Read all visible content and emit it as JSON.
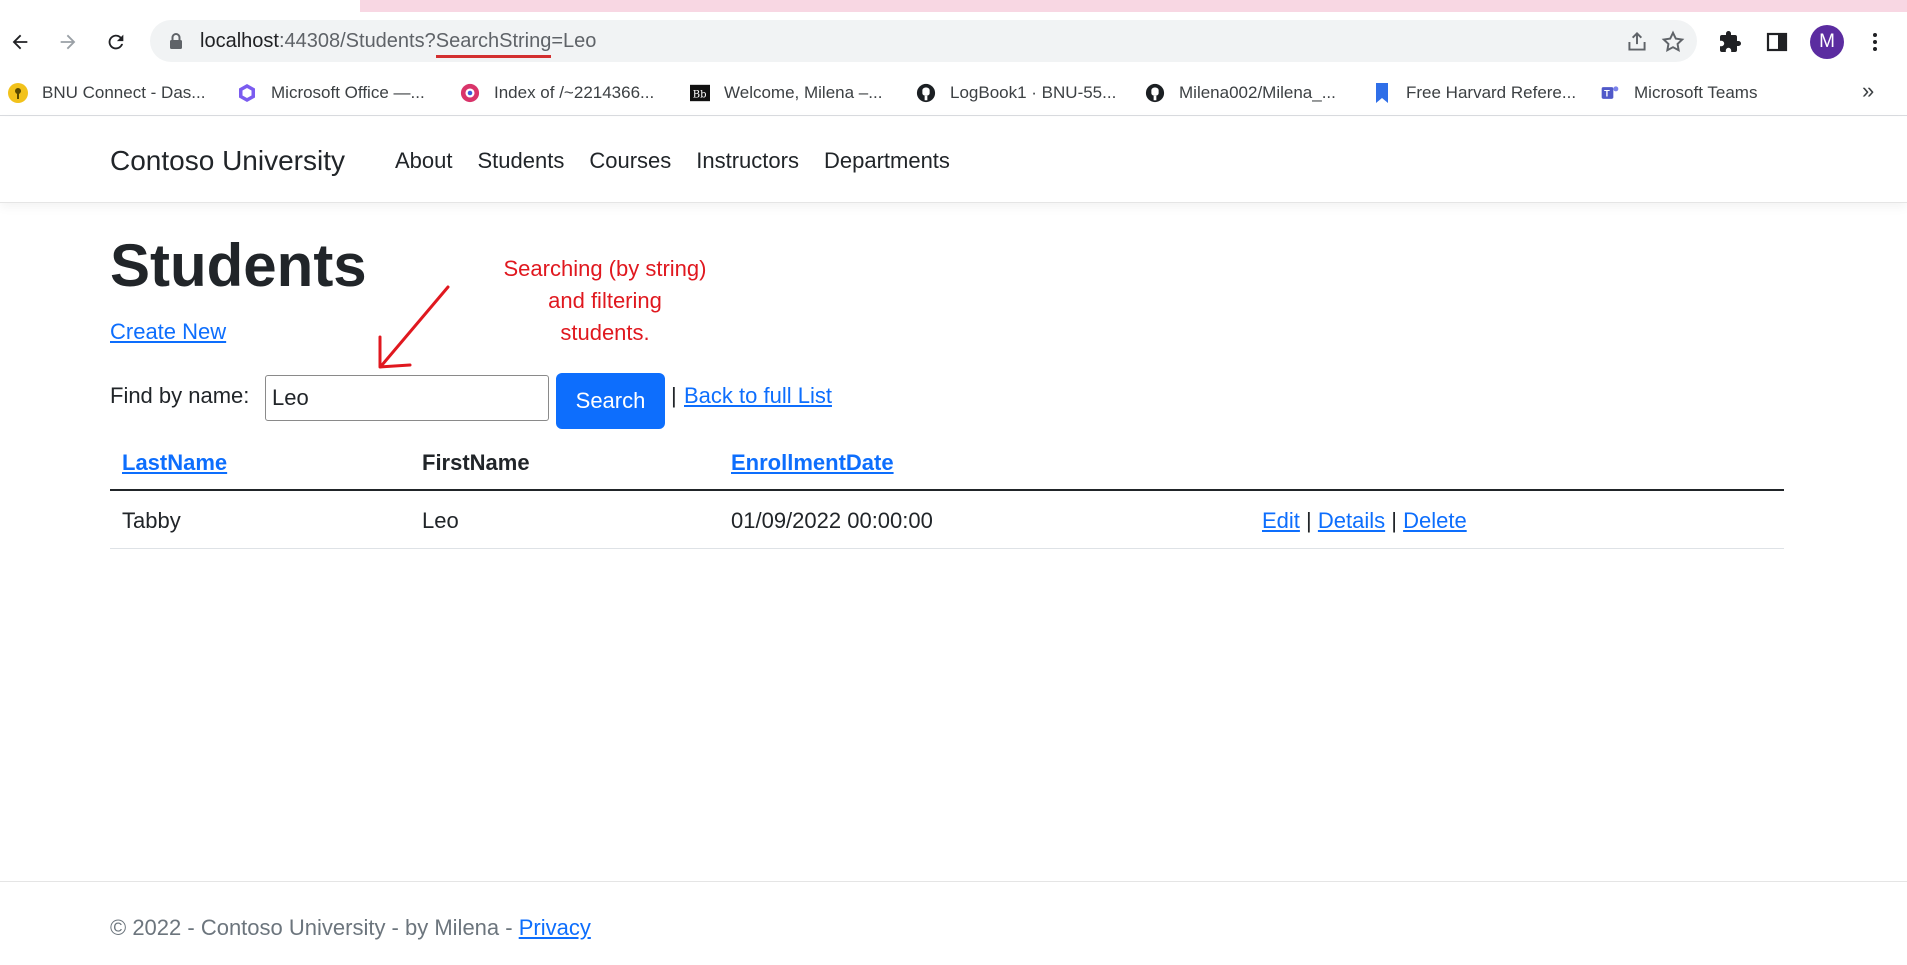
{
  "browser": {
    "url_host": "localhost",
    "url_path_pre": ":44308/Students?",
    "url_param": "SearchString",
    "url_value": "=Leo",
    "avatar_letter": "M",
    "bookmarks": [
      {
        "label": "BNU Connect - Das...",
        "icon": "key-icon"
      },
      {
        "label": "Microsoft Office —...",
        "icon": "office-icon"
      },
      {
        "label": "Index of /~2214366...",
        "icon": "globe-icon"
      },
      {
        "label": "Welcome, Milena –...",
        "icon": "blackboard-icon"
      },
      {
        "label": "LogBook1 · BNU-55...",
        "icon": "github-icon"
      },
      {
        "label": "Milena002/Milena_...",
        "icon": "github-icon"
      },
      {
        "label": "Free Harvard Refere...",
        "icon": "bookmark-icon"
      },
      {
        "label": "Microsoft Teams",
        "icon": "teams-icon"
      }
    ],
    "more_label": "»"
  },
  "navbar": {
    "brand": "Contoso University",
    "links": [
      "About",
      "Students",
      "Courses",
      "Instructors",
      "Departments"
    ]
  },
  "main": {
    "title": "Students",
    "create_new": "Create New",
    "annotation": [
      "Searching (by string)",
      "and filtering",
      "students."
    ],
    "find_label": "Find by name:",
    "search_value": "Leo",
    "search_button": "Search",
    "separator": "|",
    "back_link": "Back to full List"
  },
  "table": {
    "headers": [
      "LastName",
      "FirstName",
      "EnrollmentDate"
    ],
    "rows": [
      {
        "last": "Tabby",
        "first": "Leo",
        "date": "01/09/2022 00:00:00",
        "edit": "Edit",
        "details": "Details",
        "delete": "Delete"
      }
    ],
    "pipe": "|"
  },
  "footer": {
    "text": "© 2022 - Contoso University - by Milena - ",
    "privacy": "Privacy"
  },
  "colors": {
    "link": "#0d6efd",
    "annotation": "#e0181f",
    "button": "#0d6efd"
  }
}
